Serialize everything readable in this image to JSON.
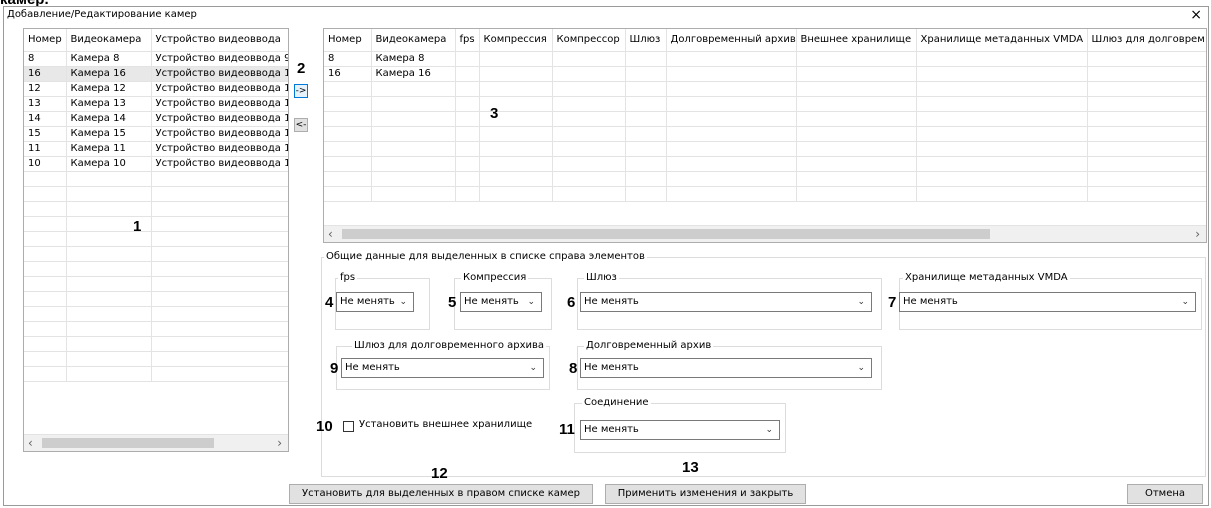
{
  "cut_caption": "камер.",
  "window": {
    "title": "Добавление/Редактирование камер",
    "close_glyph": "×"
  },
  "left_table": {
    "columns": [
      "Номер",
      "Видеокамера",
      "Устройство видеоввода"
    ],
    "rows": [
      [
        "8",
        "Камера 8",
        "Устройство видеоввода 9"
      ],
      [
        "16",
        "Камера 16",
        "Устройство видеоввода 1"
      ],
      [
        "12",
        "Камера 12",
        "Устройство видеоввода 1"
      ],
      [
        "13",
        "Камера 13",
        "Устройство видеоввода 1"
      ],
      [
        "14",
        "Камера 14",
        "Устройство видеоввода 1"
      ],
      [
        "15",
        "Камера 15",
        "Устройство видеоввода 1"
      ],
      [
        "11",
        "Камера 11",
        "Устройство видеоввода 1"
      ],
      [
        "10",
        "Камера 10",
        "Устройство видеоввода 1"
      ]
    ],
    "selected_row": 1
  },
  "transfer": {
    "add_label": "->",
    "remove_label": "<-"
  },
  "right_table": {
    "columns": [
      "Номер",
      "Видеокамера",
      "fps",
      "Компрессия",
      "Компрессор",
      "Шлюз",
      "Долговременный архив",
      "Внешнее хранилище",
      "Хранилище метаданных VMDA",
      "Шлюз для долговрем"
    ],
    "rows": [
      [
        "8",
        "Камера 8"
      ],
      [
        "16",
        "Камера 16"
      ]
    ]
  },
  "common": {
    "title": "Общие данные для выделенных в списке справа элементов",
    "fps_label": "fps",
    "fps_value": "Не менять",
    "compression_label": "Компрессия",
    "compression_value": "Не менять",
    "gateway_label": "Шлюз",
    "gateway_value": "Не менять",
    "vmda_label": "Хранилище метаданных VMDA",
    "vmda_value": "Не менять",
    "archive_gateway_label": "Шлюз для долговременного архива",
    "archive_gateway_value": "Не менять",
    "archive_label": "Долговременный архив",
    "archive_value": "Не менять",
    "external_storage_label": "Установить внешнее хранилище",
    "external_storage_checked": false,
    "connection_label": "Соединение",
    "connection_value": "Не менять"
  },
  "buttons": {
    "apply_selected": "Установить для выделенных в правом списке камер",
    "apply_close": "Применить изменения и закрыть",
    "cancel": "Отмена"
  },
  "callouts": [
    "1",
    "2",
    "3",
    "4",
    "5",
    "6",
    "7",
    "8",
    "9",
    "10",
    "11",
    "12",
    "13"
  ],
  "icons": {
    "dropdown": "chevron-down-icon",
    "scroll_left": "arrow-left-icon",
    "scroll_right": "arrow-right-icon"
  }
}
